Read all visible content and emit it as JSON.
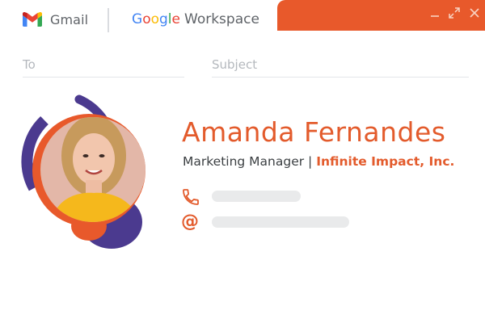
{
  "topbar": {
    "gmail_label": "Gmail",
    "workspace_parts": [
      "G",
      "o",
      "o",
      "g",
      "l",
      "e"
    ],
    "workspace_word": "Workspace"
  },
  "window_controls": {
    "icons": [
      "minimize-icon",
      "expand-icon",
      "close-icon"
    ]
  },
  "compose": {
    "to_placeholder": "To",
    "subject_placeholder": "Subject"
  },
  "signature": {
    "name": "Amanda Fernandes",
    "role": "Marketing Manager",
    "separator": " | ",
    "company": "Infinite Impact, Inc.",
    "phone_icon": "phone-icon",
    "email_icon_glyph": "@"
  },
  "colors": {
    "accent_orange": "#e8592b",
    "accent_purple": "#4b3a8f",
    "avatar_yellow": "#f5b81c",
    "placeholder_gray": "#e9eaeb"
  }
}
